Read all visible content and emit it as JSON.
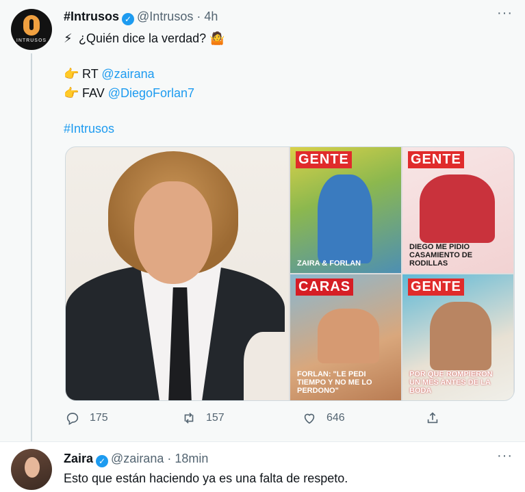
{
  "tweet": {
    "author_name": "#Intrusos",
    "handle": "@Intrusos",
    "separator": "·",
    "time": "4h",
    "more": "···",
    "avatar_text": "INTRUSOS",
    "line1_emoji": "⚡",
    "line1_text": "¿Quién dice la verdad? 🤷",
    "rt_emoji": "👉",
    "rt_label": "RT",
    "rt_mention": "@zairana",
    "fav_emoji": "👉",
    "fav_label": "FAV",
    "fav_mention": "@DiegoForlan7",
    "hashtag": "#Intrusos",
    "covers": [
      {
        "masthead": "GENTE",
        "headline": "ZAIRA & FORLAN"
      },
      {
        "masthead": "GENTE",
        "headline": "DIEGO ME PIDIO CASAMIENTO DE RODILLAS"
      },
      {
        "masthead": "CARAS",
        "headline": "FORLAN: \"LE PEDI TIEMPO Y NO ME LO PERDONO\""
      },
      {
        "masthead": "GENTE",
        "headline": "POR QUE ROMPIERON UN MES ANTES DE LA BODA"
      }
    ],
    "actions": {
      "reply_count": "175",
      "retweet_count": "157",
      "like_count": "646"
    }
  },
  "reply": {
    "author_name": "Zaira",
    "handle": "@zairana",
    "separator": "·",
    "time": "18min",
    "more": "···",
    "text": "Esto que están haciendo ya es una falta de respeto."
  },
  "colors": {
    "link": "#1d9bf0",
    "secondary_text": "#536471",
    "verified": "#1d9bf0"
  }
}
